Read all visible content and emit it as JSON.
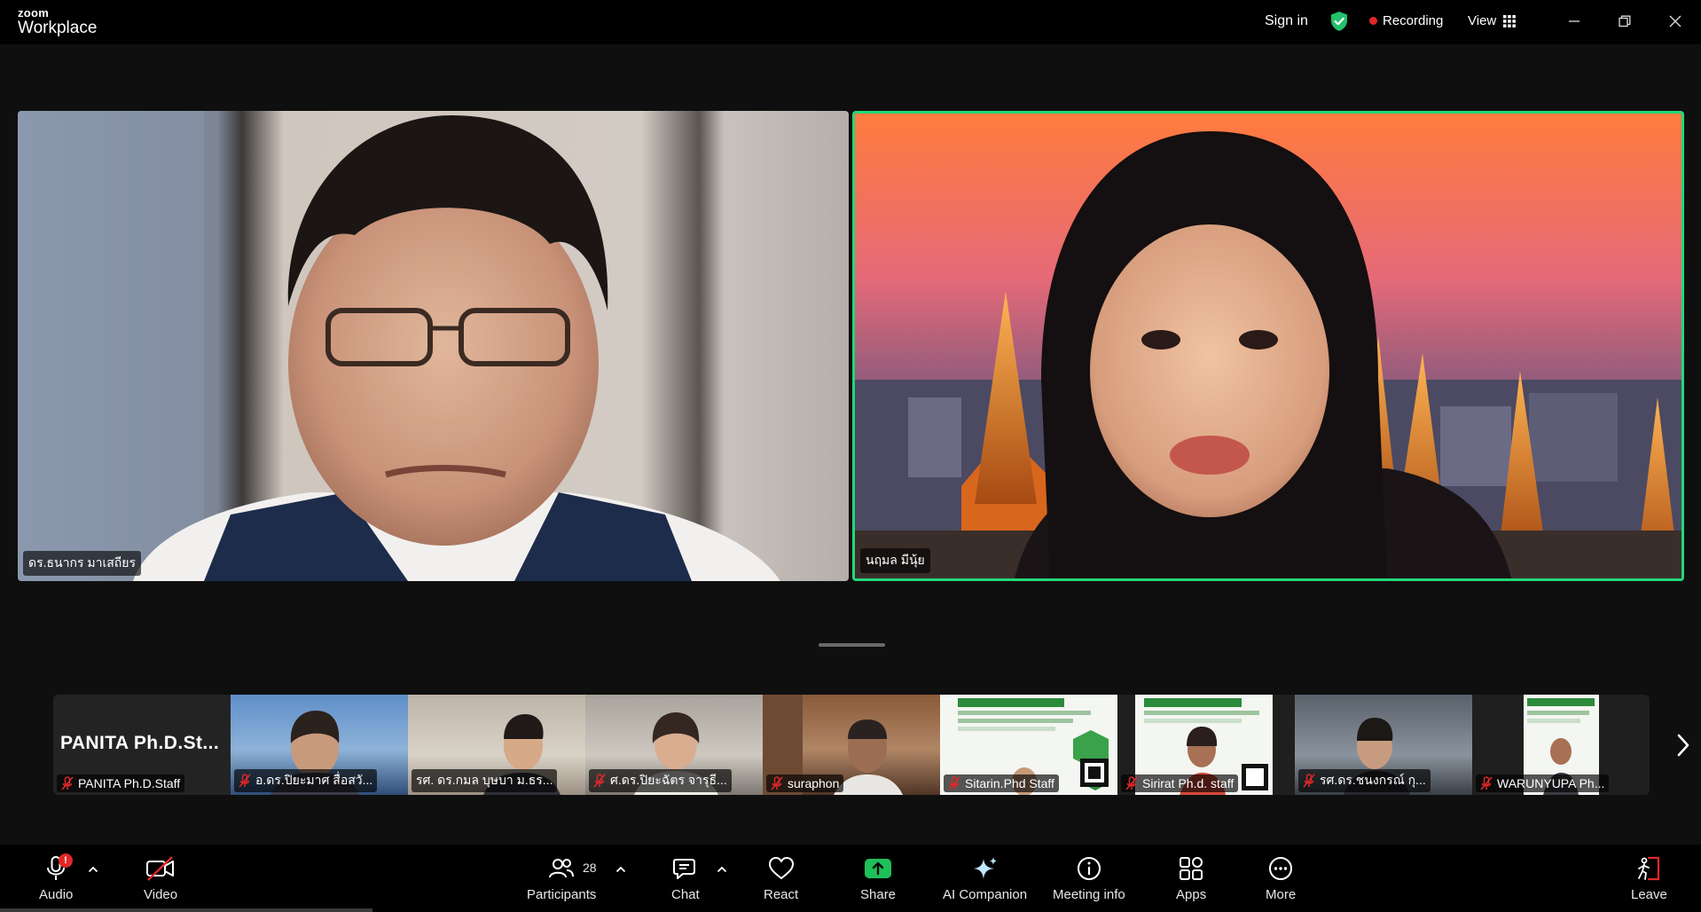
{
  "app": {
    "brand_small": "zoom",
    "brand_large": "Workplace"
  },
  "titlebar": {
    "sign_in": "Sign in",
    "recording": "Recording",
    "view": "View",
    "icons": [
      "shield-check-icon",
      "grid-icon",
      "minimize-icon",
      "restore-icon",
      "close-icon"
    ]
  },
  "main_tiles": [
    {
      "name": "ดร.ธนากร  มาเสถียร",
      "active_speaker": false
    },
    {
      "name": "นฤมล  มีนุ้ย",
      "active_speaker": true
    }
  ],
  "thumbnails": [
    {
      "name": "PANITA Ph.D.Staff",
      "display_name": "PANITA  Ph.D.St...",
      "video": false
    },
    {
      "name": "อ.ดร.ปิยะมาศ  สื่อสวั...",
      "video": true
    },
    {
      "name": "รศ. ดร.กมล บุษบา ม.ธร...",
      "video": true
    },
    {
      "name": "ศ.ดร.ปิยะฉัตร  จารุธี...",
      "video": true
    },
    {
      "name": "suraphon",
      "video": true
    },
    {
      "name": "Sitarin.Phd Staff",
      "video": true
    },
    {
      "name": "Sirirat Ph.d. staff",
      "video": true
    },
    {
      "name": "รศ.ดร.ชนงกรณ์  กุ...",
      "video": true
    },
    {
      "name": "WARUNYUPA Ph...",
      "video": true
    }
  ],
  "toolbar": {
    "audio": "Audio",
    "audio_badge": "!",
    "video": "Video",
    "participants": "Participants",
    "participants_count": "28",
    "chat": "Chat",
    "react": "React",
    "share": "Share",
    "ai_companion": "AI Companion",
    "meeting_info": "Meeting info",
    "apps": "Apps",
    "more": "More",
    "leave": "Leave"
  },
  "colors": {
    "active_speaker_border": "#23d879",
    "share_green": "#1fbf5a",
    "recording_red": "#e02828",
    "muted_red": "#e02828"
  }
}
